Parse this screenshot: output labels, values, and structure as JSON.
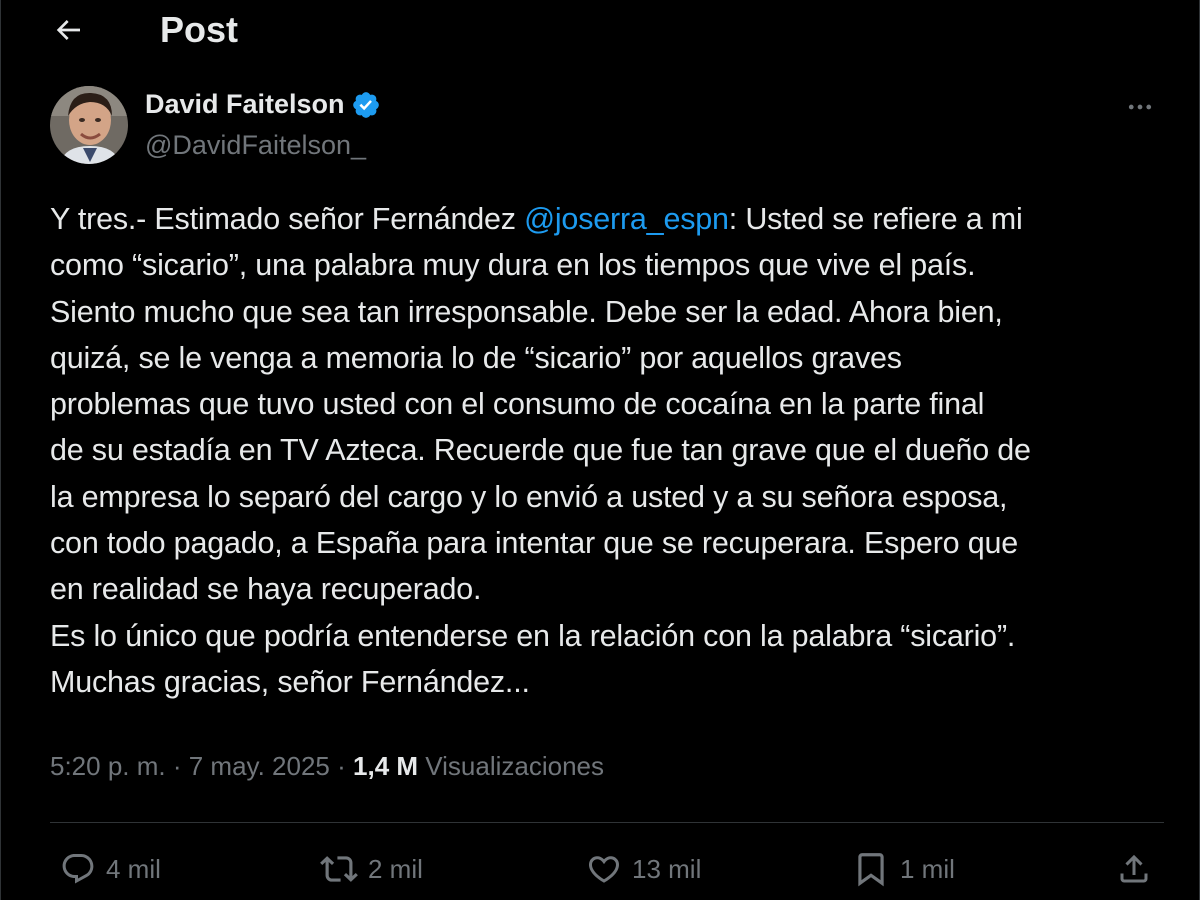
{
  "header": {
    "title": "Post",
    "back_icon": "arrow-left-icon"
  },
  "author": {
    "name": "David Faitelson",
    "handle": "@DavidFaitelson_",
    "verified": true,
    "verified_color": "#1d9bf0",
    "more_icon": "more-horizontal-icon"
  },
  "tweet": {
    "lines": [
      {
        "before": "Y tres.- Estimado señor Fernández ",
        "mention": "@joserra_espn",
        "after": ": Usted se refiere a mi"
      },
      "como “sicario”, una palabra muy dura en los tiempos que vive el país.",
      "Siento mucho que sea tan irresponsable. Debe ser la edad. Ahora bien,",
      "quizá, se le venga a memoria lo de “sicario” por aquellos graves",
      "problemas que tuvo usted con el consumo de cocaína en la parte final",
      "de su estadía en TV Azteca. Recuerde que fue tan grave que el dueño de",
      "la empresa lo separó del cargo y lo envió a usted y a su señora esposa,",
      "con todo pagado, a España para intentar que se recuperara. Espero que",
      "en realidad se haya recuperado.",
      "Es lo único que podría entenderse en la relación con la palabra “sicario”.",
      "Muchas gracias, señor Fernández..."
    ]
  },
  "meta": {
    "time": "5:20 p. m.",
    "separator": " · ",
    "date": "7 may. 2025",
    "views_count": "1,4 M",
    "views_label": "Visualizaciones"
  },
  "actions": {
    "replies": {
      "icon": "reply-icon",
      "count": "4 mil"
    },
    "reposts": {
      "icon": "repost-icon",
      "count": "2 mil"
    },
    "likes": {
      "icon": "heart-icon",
      "count": "13 mil"
    },
    "bookmarks": {
      "icon": "bookmark-icon",
      "count": "1 mil"
    },
    "share": {
      "icon": "share-icon"
    }
  },
  "colors": {
    "background": "#000000",
    "text": "#e7e9ea",
    "secondary": "#71767b",
    "accent": "#1d9bf0",
    "divider": "#2f3336"
  }
}
